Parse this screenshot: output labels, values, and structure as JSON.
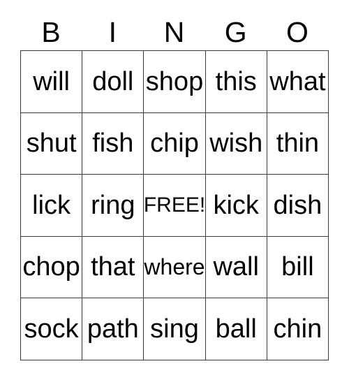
{
  "card": {
    "headers": [
      "B",
      "I",
      "N",
      "G",
      "O"
    ],
    "rows": [
      [
        {
          "text": "will",
          "size": "normal"
        },
        {
          "text": "doll",
          "size": "normal"
        },
        {
          "text": "shop",
          "size": "normal"
        },
        {
          "text": "this",
          "size": "normal"
        },
        {
          "text": "what",
          "size": "normal"
        }
      ],
      [
        {
          "text": "shut",
          "size": "normal"
        },
        {
          "text": "fish",
          "size": "normal"
        },
        {
          "text": "chip",
          "size": "normal"
        },
        {
          "text": "wish",
          "size": "normal"
        },
        {
          "text": "thin",
          "size": "normal"
        }
      ],
      [
        {
          "text": "lick",
          "size": "normal"
        },
        {
          "text": "ring",
          "size": "normal"
        },
        {
          "text": "FREE!",
          "size": "small"
        },
        {
          "text": "kick",
          "size": "normal"
        },
        {
          "text": "dish",
          "size": "normal"
        }
      ],
      [
        {
          "text": "chop",
          "size": "normal"
        },
        {
          "text": "that",
          "size": "normal"
        },
        {
          "text": "where",
          "size": "medium"
        },
        {
          "text": "wall",
          "size": "normal"
        },
        {
          "text": "bill",
          "size": "normal"
        }
      ],
      [
        {
          "text": "sock",
          "size": "normal"
        },
        {
          "text": "path",
          "size": "normal"
        },
        {
          "text": "sing",
          "size": "normal"
        },
        {
          "text": "ball",
          "size": "normal"
        },
        {
          "text": "chin",
          "size": "normal"
        }
      ]
    ]
  },
  "colors": {
    "background": "#ffffff",
    "border": "#3a3a3a",
    "text": "#000000"
  }
}
